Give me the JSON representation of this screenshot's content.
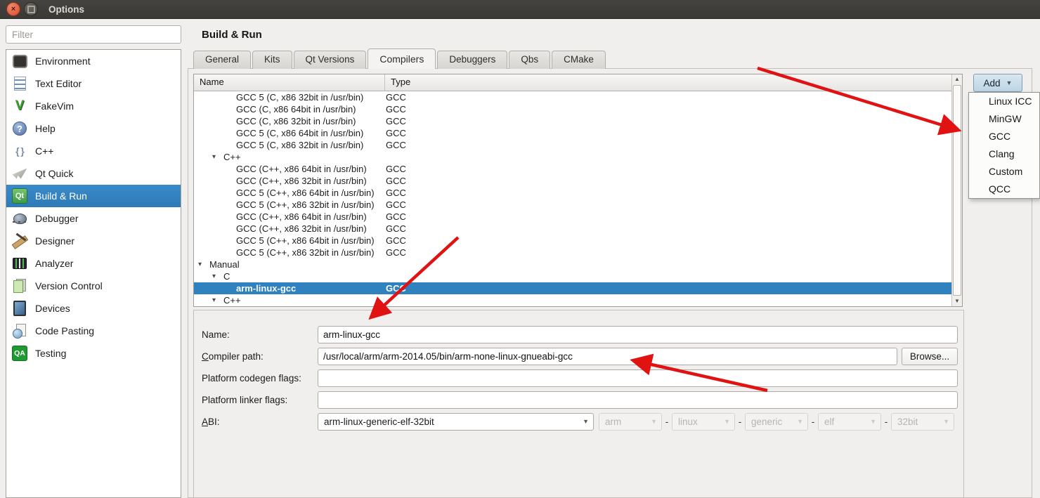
{
  "window": {
    "title": "Options"
  },
  "sidebar": {
    "filter_placeholder": "Filter",
    "selected": "Build & Run",
    "items": [
      {
        "label": "Environment",
        "icon": "environment-icon"
      },
      {
        "label": "Text Editor",
        "icon": "text-editor-icon"
      },
      {
        "label": "FakeVim",
        "icon": "fakevim-icon"
      },
      {
        "label": "Help",
        "icon": "help-icon"
      },
      {
        "label": "C++",
        "icon": "cpp-icon"
      },
      {
        "label": "Qt Quick",
        "icon": "qt-quick-icon"
      },
      {
        "label": "Build & Run",
        "icon": "build-run-icon"
      },
      {
        "label": "Debugger",
        "icon": "debugger-icon"
      },
      {
        "label": "Designer",
        "icon": "designer-icon"
      },
      {
        "label": "Analyzer",
        "icon": "analyzer-icon"
      },
      {
        "label": "Version Control",
        "icon": "version-control-icon"
      },
      {
        "label": "Devices",
        "icon": "devices-icon"
      },
      {
        "label": "Code Pasting",
        "icon": "code-pasting-icon"
      },
      {
        "label": "Testing",
        "icon": "testing-icon"
      }
    ]
  },
  "page": {
    "title": "Build & Run"
  },
  "tabs": {
    "active": "Compilers",
    "items": [
      "General",
      "Kits",
      "Qt Versions",
      "Compilers",
      "Debuggers",
      "Qbs",
      "CMake"
    ]
  },
  "table": {
    "columns": [
      "Name",
      "Type"
    ],
    "rows": [
      {
        "name": "GCC 5 (C, x86 32bit in /usr/bin)",
        "type": "GCC",
        "level": 2
      },
      {
        "name": "GCC (C, x86 64bit in /usr/bin)",
        "type": "GCC",
        "level": 2
      },
      {
        "name": "GCC (C, x86 32bit in /usr/bin)",
        "type": "GCC",
        "level": 2
      },
      {
        "name": "GCC 5 (C, x86 64bit in /usr/bin)",
        "type": "GCC",
        "level": 2
      },
      {
        "name": "GCC 5 (C, x86 32bit in /usr/bin)",
        "type": "GCC",
        "level": 2
      },
      {
        "name": "C++",
        "type": "",
        "level": 1,
        "group": true
      },
      {
        "name": "GCC (C++, x86 64bit in /usr/bin)",
        "type": "GCC",
        "level": 2
      },
      {
        "name": "GCC (C++, x86 32bit in /usr/bin)",
        "type": "GCC",
        "level": 2
      },
      {
        "name": "GCC 5 (C++, x86 64bit in /usr/bin)",
        "type": "GCC",
        "level": 2
      },
      {
        "name": "GCC 5 (C++, x86 32bit in /usr/bin)",
        "type": "GCC",
        "level": 2
      },
      {
        "name": "GCC (C++, x86 64bit in /usr/bin)",
        "type": "GCC",
        "level": 2
      },
      {
        "name": "GCC (C++, x86 32bit in /usr/bin)",
        "type": "GCC",
        "level": 2
      },
      {
        "name": "GCC 5 (C++, x86 64bit in /usr/bin)",
        "type": "GCC",
        "level": 2
      },
      {
        "name": "GCC 5 (C++, x86 32bit in /usr/bin)",
        "type": "GCC",
        "level": 2
      },
      {
        "name": "Manual",
        "type": "",
        "level": 0,
        "group": true
      },
      {
        "name": "C",
        "type": "",
        "level": 1,
        "group": true
      },
      {
        "name": "arm-linux-gcc",
        "type": "GCC",
        "level": 2,
        "selected": true
      },
      {
        "name": "C++",
        "type": "",
        "level": 1,
        "group": true
      }
    ]
  },
  "add_menu": {
    "button_label": "Add",
    "items": [
      "Linux ICC",
      "MinGW",
      "GCC",
      "Clang",
      "Custom",
      "QCC"
    ]
  },
  "form": {
    "name_label": "Name:",
    "name_value": "arm-linux-gcc",
    "compiler_path_label": "Compiler path:",
    "compiler_path_mnemonic": "C",
    "compiler_path_value": "/usr/local/arm/arm-2014.05/bin/arm-none-linux-gnueabi-gcc",
    "browse_label": "Browse...",
    "codegen_label": "Platform codegen flags:",
    "codegen_value": "",
    "linker_label": "Platform linker flags:",
    "linker_value": "",
    "abi_label": "ABI:",
    "abi_mnemonic": "A",
    "abi_value": "arm-linux-generic-elf-32bit",
    "abi_parts": [
      "arm",
      "linux",
      "generic",
      "elf",
      "32bit"
    ]
  },
  "colors": {
    "selection_blue": "#2f81c0",
    "annotation_arrow_red": "#e01212",
    "titlebar": "#3a3935",
    "add_button_blue": "#c6daea"
  }
}
